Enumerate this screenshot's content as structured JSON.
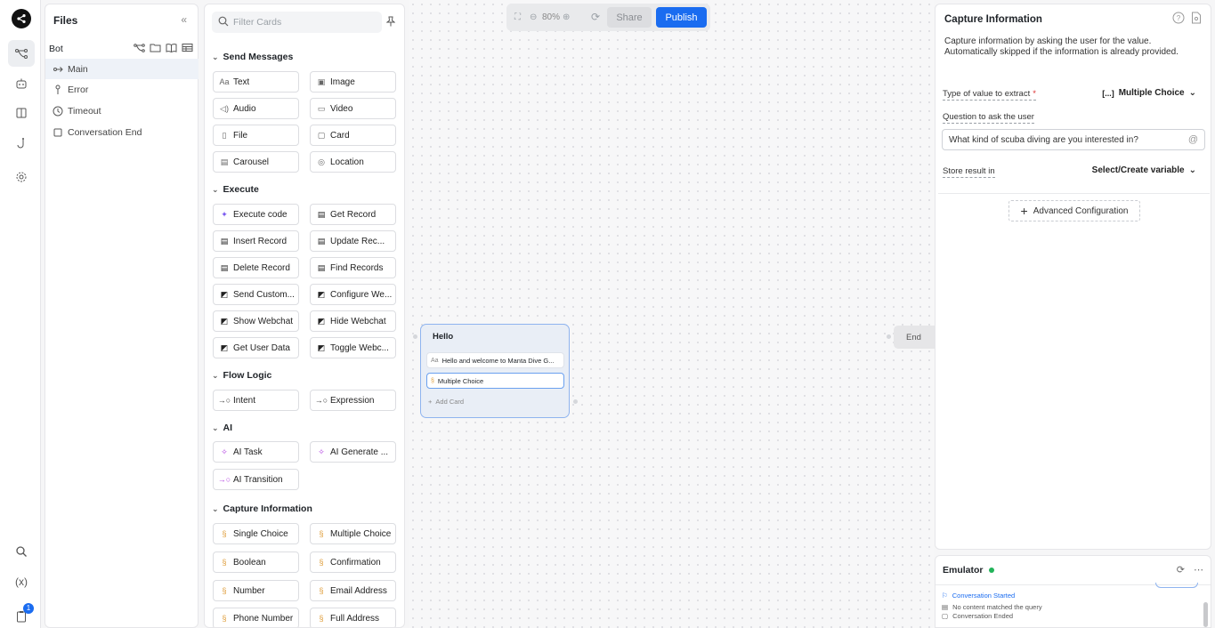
{
  "rail": {
    "badge_count": "1",
    "icons": [
      "share-logo-icon",
      "flow-icon",
      "bot-icon",
      "book-icon",
      "hook-icon",
      "settings-icon",
      "search-icon",
      "variable-icon",
      "clipboard-icon"
    ]
  },
  "files": {
    "title": "Files",
    "bot_label": "Bot",
    "items": [
      {
        "label": "Main",
        "icon": "flow-icon"
      },
      {
        "label": "Error",
        "icon": "error-icon"
      },
      {
        "label": "Timeout",
        "icon": "clock-icon"
      },
      {
        "label": "Conversation End",
        "icon": "square-icon"
      }
    ]
  },
  "cards_panel": {
    "filter_placeholder": "Filter Cards",
    "sections": {
      "send_messages": {
        "title": "Send Messages",
        "cards": [
          "Text",
          "Image",
          "Audio",
          "Video",
          "File",
          "Card",
          "Carousel",
          "Location"
        ]
      },
      "execute": {
        "title": "Execute",
        "cards": [
          "Execute code",
          "Get Record",
          "Insert Record",
          "Update Rec...",
          "Delete Record",
          "Find Records",
          "Send Custom...",
          "Configure We...",
          "Show Webchat",
          "Hide Webchat",
          "Get User Data",
          "Toggle Webc..."
        ]
      },
      "flow_logic": {
        "title": "Flow Logic",
        "cards": [
          "Intent",
          "Expression"
        ]
      },
      "ai": {
        "title": "AI",
        "cards": [
          "AI Task",
          "AI Generate ...",
          "AI Transition"
        ]
      },
      "capture": {
        "title": "Capture Information",
        "cards": [
          "Single Choice",
          "Multiple Choice",
          "Boolean",
          "Confirmation",
          "Number",
          "Email Address",
          "Phone Number",
          "Full Address"
        ]
      }
    }
  },
  "toolbar": {
    "zoom": "80%",
    "share_label": "Share",
    "publish_label": "Publish",
    "publish_color": "#1a6cf0"
  },
  "canvas": {
    "node": {
      "title": "Hello",
      "cards": [
        "Hello and welcome to Manta Dive G...",
        "Multiple Choice"
      ],
      "add_card": "Add Card"
    },
    "end_node": "End"
  },
  "inspector": {
    "title": "Capture Information",
    "description": "Capture information by asking the user for the value. Automatically skipped if the information is already provided.",
    "type_label": "Type of value to extract",
    "type_required": "*",
    "type_value_prefix": "[...]",
    "type_value": "Multiple Choice",
    "question_label": "Question to ask the user",
    "question_value": "What kind of scuba diving are you interested in?",
    "store_label": "Store result in",
    "store_value": "Select/Create variable",
    "advanced_label": "Advanced Configuration"
  },
  "emulator": {
    "title": "Emulator",
    "status_color": "#22b35a",
    "lines": [
      "Conversation Started",
      "No content matched the query",
      "Conversation Ended"
    ]
  }
}
